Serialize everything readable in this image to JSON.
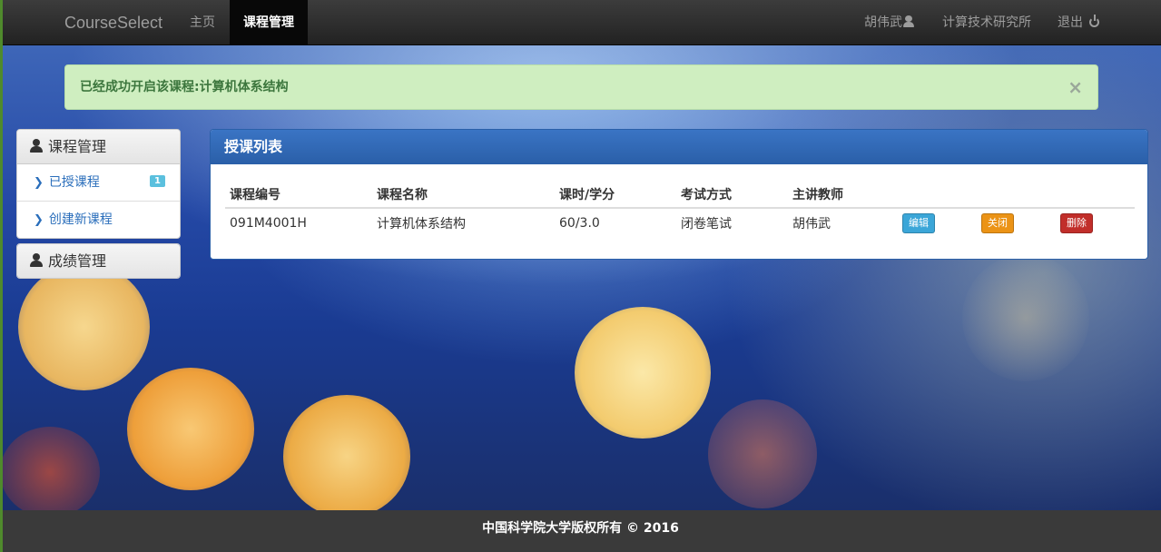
{
  "navbar": {
    "brand": "CourseSelect",
    "links": [
      {
        "label": "主页"
      },
      {
        "label": "课程管理"
      }
    ],
    "user_name": "胡伟武",
    "department": "计算技术研究所",
    "logout": "退出"
  },
  "alert": {
    "message": "已经成功开启该课程:计算机体系结构",
    "close": "×"
  },
  "sidebar": {
    "course_panel": {
      "title": "课程管理",
      "items": [
        {
          "label": "已授课程",
          "badge": "1"
        },
        {
          "label": "创建新课程"
        }
      ]
    },
    "grade_panel": {
      "title": "成绩管理"
    }
  },
  "main": {
    "title": "授课列表",
    "columns": [
      "课程编号",
      "课程名称",
      "课时/学分",
      "考试方式",
      "主讲教师"
    ],
    "rows": [
      {
        "code": "091M4001H",
        "name": "计算机体系结构",
        "hours_credits": "60/3.0",
        "exam": "闭卷笔试",
        "teacher": "胡伟武",
        "actions": {
          "edit": "编辑",
          "close": "关闭",
          "delete": "删除"
        }
      }
    ]
  },
  "footer": {
    "text": "中国科学院大学版权所有 © 2016"
  },
  "colors": {
    "primary": "#2a5fa8",
    "success_bg": "#cfeec0",
    "info": "#3ba6d8",
    "warning": "#eb9316",
    "danger": "#c12e2a"
  }
}
